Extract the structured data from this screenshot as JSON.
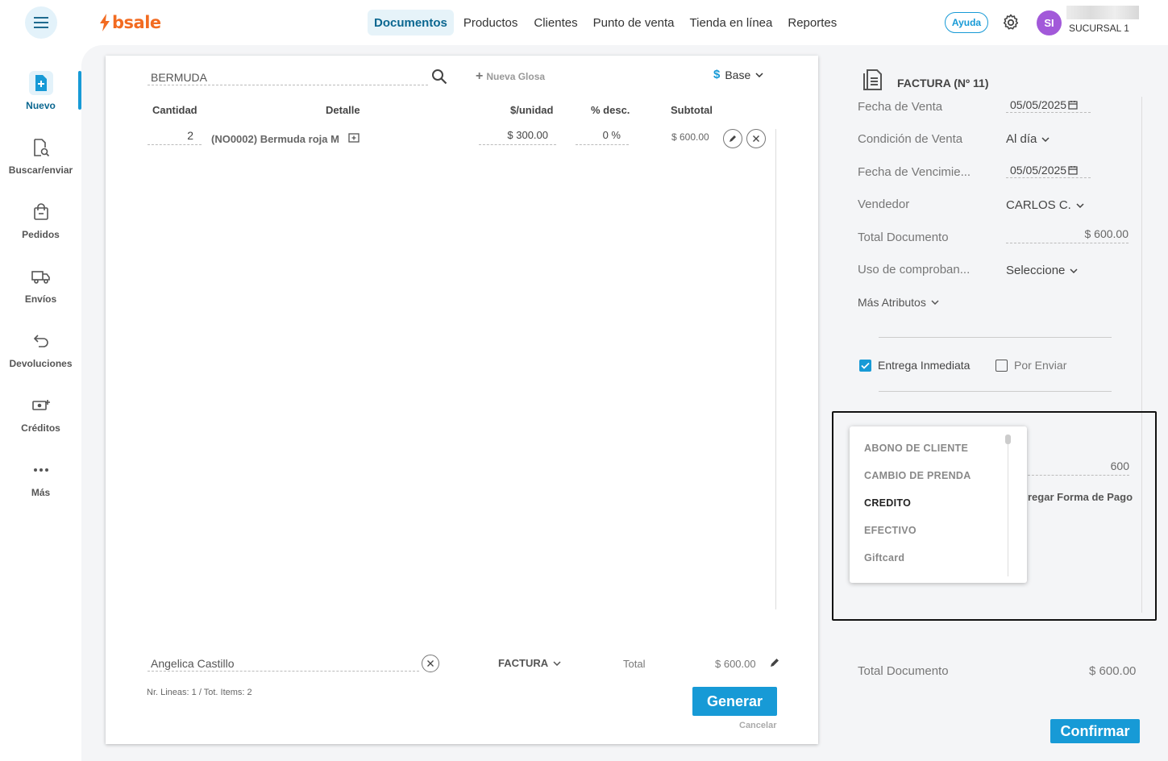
{
  "app": {
    "logo_text": "bsale",
    "nav": [
      "Documentos",
      "Productos",
      "Clientes",
      "Punto de venta",
      "Tienda en línea",
      "Reportes"
    ],
    "help_label": "Ayuda",
    "avatar_initials": "SI",
    "branch": "SUCURSAL 1"
  },
  "sidebar": {
    "items": [
      {
        "label": "Nuevo",
        "icon": "new-document-icon"
      },
      {
        "label": "Buscar/enviar",
        "icon": "search-document-icon"
      },
      {
        "label": "Pedidos",
        "icon": "bag-icon"
      },
      {
        "label": "Envíos",
        "icon": "truck-icon"
      },
      {
        "label": "Devoluciones",
        "icon": "return-arrow-icon"
      },
      {
        "label": "Créditos",
        "icon": "money-icon"
      },
      {
        "label": "Más",
        "icon": "more-dots-icon"
      }
    ]
  },
  "document": {
    "search_value": "BERMUDA",
    "new_glosa_label": "Nueva Glosa",
    "price_list_symbol": "$",
    "price_list_label": "Base",
    "columns": {
      "qty": "Cantidad",
      "detail": "Detalle",
      "unit": "$/unidad",
      "disc": "% desc.",
      "subtotal": "Subtotal"
    },
    "rows": [
      {
        "qty": "2",
        "detail": "(NO0002) Bermuda roja M",
        "unit": "$ 300.00",
        "disc": "0 %",
        "subtotal": "$ 600.00"
      }
    ],
    "client": "Angelica Castillo",
    "doc_type": "FACTURA",
    "total_label": "Total",
    "total_value": "$ 600.00",
    "summary": "Nr. Lineas: 1 / Tot. Items: 2",
    "generate_label": "Generar",
    "cancel_label": "Cancelar"
  },
  "panel": {
    "title": "FACTURA (Nº 11)",
    "fields": [
      {
        "label": "Fecha de Venta",
        "value": "05/05/2025"
      },
      {
        "label": "Condición de Venta",
        "value": "Al día"
      },
      {
        "label": "Fecha de Vencimie...",
        "value": "05/05/2025"
      },
      {
        "label": "Vendedor",
        "value": "CARLOS C."
      },
      {
        "label": "Total Documento",
        "value": "$ 600.00"
      },
      {
        "label": "Uso de comproban...",
        "value": "Seleccione"
      }
    ],
    "more_attributes": "Más Atributos",
    "delivery_immediate": "Entrega Inmediata",
    "delivery_immediate_checked": true,
    "to_send": "Por Enviar",
    "to_send_checked": false,
    "payment_amount": "600",
    "add_payment_label": "regar Forma de Pago",
    "payment_options": [
      "ABONO DE CLIENTE",
      "CAMBIO DE PRENDA",
      "CREDITO",
      "EFECTIVO",
      "Giftcard"
    ],
    "selected_payment": "CREDITO",
    "total_doc_label": "Total Documento",
    "total_doc_value": "$ 600.00",
    "confirm_label": "Confirmar"
  },
  "colors": {
    "accent": "#179ad6",
    "brand": "#f26b21",
    "avatar": "#a259d9"
  }
}
